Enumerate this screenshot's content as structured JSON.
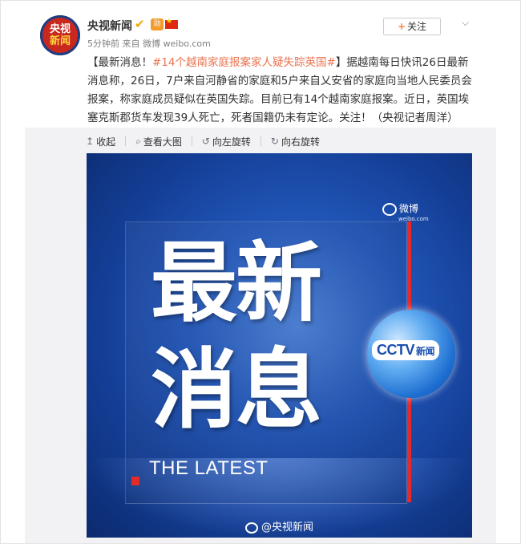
{
  "post": {
    "avatar_line1": "央视",
    "avatar_line2": "新闻",
    "nickname": "央视新闻",
    "verified_icon": "verified-v-icon",
    "medal_text": "勋",
    "time": "5分钟前",
    "from_label": "来自",
    "source": "微博 weibo.com",
    "follow_label": "关注",
    "text_prefix": "【最新消息！",
    "topic": "#14个越南家庭报案家人疑失踪英国#",
    "text_body": "】据越南每日快讯26日最新消息称，26日，7户来自河静省的家庭和5户来自乂安省的家庭向当地人民委员会报案，称家庭成员疑似在英国失踪。目前已有14个越南家庭报案。近日，英国埃塞克斯郡货车发现39人死亡，死者国籍仍未有定论。关注！（央视记者周洋）"
  },
  "toolbar": {
    "collapse": "收起",
    "view_large": "查看大图",
    "rotate_left": "向左旋转",
    "rotate_right": "向右旋转"
  },
  "poster": {
    "headline_1": "最新",
    "headline_2": "消息",
    "subtitle": "THE LATEST",
    "weibo_logo_text": "微博",
    "weibo_logo_sub": "weibo.com",
    "cctv_logo": "CCTV",
    "cctv_news": "新闻",
    "watermark": "@央视新闻"
  },
  "colors": {
    "topic_link": "#eb7350",
    "accent_red": "#e52a2a",
    "poster_blue": "#2156b8"
  }
}
